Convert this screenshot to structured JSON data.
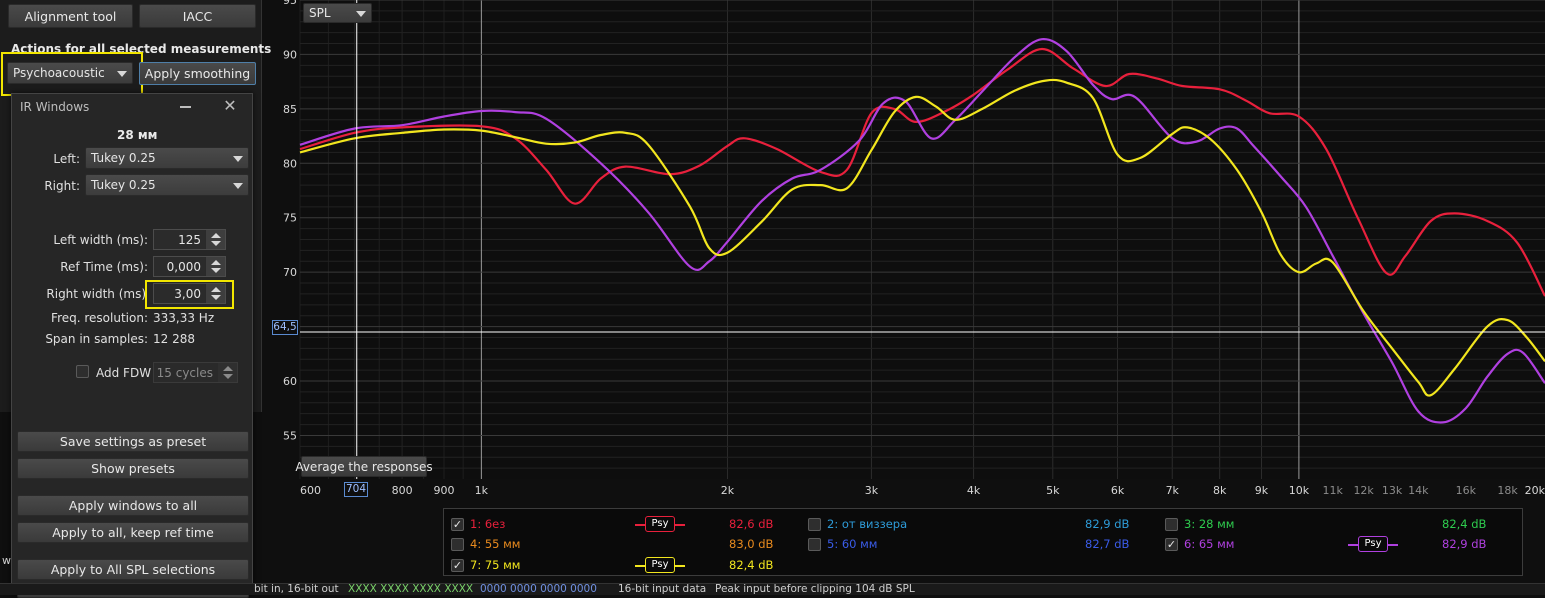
{
  "toolbar": {
    "alignment_tool": "Alignment tool",
    "iacc": "IACC",
    "actions_heading": "Actions for all selected measurements",
    "smoothing_select": "Psychoacoustic",
    "apply_smoothing": "Apply smoothing"
  },
  "ir_windows": {
    "title": "IR Windows",
    "distance": "28 мм",
    "left_label": "Left:",
    "left_value": "Tukey 0.25",
    "right_label": "Right:",
    "right_value": "Tukey 0.25",
    "left_width_label": "Left width (ms):",
    "left_width_value": "125",
    "ref_time_label": "Ref Time (ms):",
    "ref_time_value": "0,000",
    "right_width_label": "Right width (ms)",
    "right_width_value": "3,00",
    "freq_res_label": "Freq. resolution:",
    "freq_res_value": "333,33 Hz",
    "span_label": "Span in samples:",
    "span_value": "12 288",
    "add_fdw_label": "Add FDW",
    "fdw_cycles": "15 cycles",
    "save_preset": "Save settings as preset",
    "show_presets": "Show presets",
    "apply_windows_all": "Apply windows to all",
    "apply_all_keep_ref": "Apply to all, keep ref time",
    "apply_all_spl": "Apply to All SPL selections"
  },
  "chart_panel": {
    "spl_select": "SPL",
    "average_button": "Average the responses",
    "cursor_y_value": "64,5",
    "cursor_x_value": "704"
  },
  "legend": [
    {
      "label": "1: 6ез",
      "value": "82,6 dB",
      "checked": true,
      "color": "#e8203c",
      "psy": "Psy"
    },
    {
      "label": "2: от виззера",
      "value": "82,9 dB",
      "checked": false,
      "color": "#2e9bd8",
      "psy": ""
    },
    {
      "label": "3: 28 мм",
      "value": "82,4 dB",
      "checked": false,
      "color": "#2ecc4e",
      "psy": ""
    },
    {
      "label": "4: 55 мм",
      "value": "83,0 dB",
      "checked": false,
      "color": "#e88a1e",
      "psy": ""
    },
    {
      "label": "5: 60 мм",
      "value": "82,7 dB",
      "checked": false,
      "color": "#3a5ce8",
      "psy": ""
    },
    {
      "label": "6: 65 мм",
      "value": "82,9 dB",
      "checked": true,
      "color": "#b040e0",
      "psy": "Psy"
    },
    {
      "label": "7: 75 мм",
      "value": "82,4 dB",
      "checked": true,
      "color": "#f2e61e",
      "psy": "Psy"
    }
  ],
  "status_bar": {
    "bits": "bit in, 16-bit out",
    "xxxx": "XXXX XXXX   XXXX XXXX",
    "zeros": "0000 0000   0000 0000",
    "input_data": "16-bit input data",
    "peak": "Peak input before clipping 104 dB SPL"
  },
  "chart_data": {
    "type": "line",
    "x_scale": "log",
    "xlim": [
      600,
      20000
    ],
    "ylim": [
      51,
      95
    ],
    "x_ticks": [
      {
        "v": 600,
        "t": "600"
      },
      {
        "v": 800,
        "t": "800"
      },
      {
        "v": 900,
        "t": "900"
      },
      {
        "v": 1000,
        "t": "1k"
      },
      {
        "v": 2000,
        "t": "2k"
      },
      {
        "v": 3000,
        "t": "3k"
      },
      {
        "v": 4000,
        "t": "4k"
      },
      {
        "v": 5000,
        "t": "5k"
      },
      {
        "v": 6000,
        "t": "6k"
      },
      {
        "v": 7000,
        "t": "7k"
      },
      {
        "v": 8000,
        "t": "8k"
      },
      {
        "v": 9000,
        "t": "9k"
      },
      {
        "v": 10000,
        "t": "10k"
      },
      {
        "v": 11000,
        "t": "11k"
      },
      {
        "v": 12000,
        "t": "12k"
      },
      {
        "v": 13000,
        "t": "13k"
      },
      {
        "v": 14000,
        "t": "14k"
      },
      {
        "v": 16000,
        "t": "16k"
      },
      {
        "v": 18000,
        "t": "18k"
      },
      {
        "v": 20000,
        "t": "20k"
      }
    ],
    "y_ticks": [
      55,
      60,
      65,
      70,
      75,
      80,
      85,
      90,
      95
    ],
    "grid": true,
    "cursor": {
      "x": 704,
      "y": 64.5
    },
    "series": [
      {
        "color": "#e8203c",
        "points": [
          [
            600,
            81.3
          ],
          [
            700,
            82.8
          ],
          [
            800,
            83.3
          ],
          [
            1000,
            83.4
          ],
          [
            1100,
            82.3
          ],
          [
            1200,
            79.4
          ],
          [
            1300,
            76.3
          ],
          [
            1400,
            78.6
          ],
          [
            1500,
            79.7
          ],
          [
            1700,
            79.0
          ],
          [
            1850,
            79.8
          ],
          [
            2000,
            81.6
          ],
          [
            2100,
            82.3
          ],
          [
            2300,
            81.3
          ],
          [
            2600,
            79.2
          ],
          [
            2800,
            79.4
          ],
          [
            3000,
            84.6
          ],
          [
            3200,
            85.0
          ],
          [
            3400,
            83.8
          ],
          [
            3700,
            84.8
          ],
          [
            4000,
            86.3
          ],
          [
            4400,
            88.6
          ],
          [
            4850,
            90.5
          ],
          [
            5300,
            88.7
          ],
          [
            5800,
            87.1
          ],
          [
            6200,
            88.2
          ],
          [
            6700,
            87.8
          ],
          [
            7200,
            87.1
          ],
          [
            8000,
            86.8
          ],
          [
            8600,
            85.8
          ],
          [
            9200,
            84.6
          ],
          [
            10000,
            84.3
          ],
          [
            10800,
            81.3
          ],
          [
            11800,
            75.0
          ],
          [
            12800,
            69.9
          ],
          [
            13500,
            71.5
          ],
          [
            14500,
            74.7
          ],
          [
            15500,
            75.4
          ],
          [
            17000,
            74.7
          ],
          [
            18500,
            72.7
          ],
          [
            20000,
            67.8
          ]
        ]
      },
      {
        "color": "#b040e0",
        "points": [
          [
            600,
            81.7
          ],
          [
            700,
            83.2
          ],
          [
            800,
            83.5
          ],
          [
            900,
            84.3
          ],
          [
            1000,
            84.8
          ],
          [
            1100,
            84.7
          ],
          [
            1200,
            84.1
          ],
          [
            1400,
            80.0
          ],
          [
            1600,
            75.5
          ],
          [
            1800,
            70.5
          ],
          [
            1900,
            71.0
          ],
          [
            2000,
            72.8
          ],
          [
            2200,
            76.5
          ],
          [
            2400,
            78.6
          ],
          [
            2600,
            79.4
          ],
          [
            2900,
            82.1
          ],
          [
            3100,
            85.5
          ],
          [
            3300,
            85.7
          ],
          [
            3550,
            82.3
          ],
          [
            3800,
            84.0
          ],
          [
            4100,
            86.6
          ],
          [
            4500,
            89.8
          ],
          [
            4850,
            91.4
          ],
          [
            5200,
            90.3
          ],
          [
            5600,
            87.2
          ],
          [
            5900,
            85.9
          ],
          [
            6300,
            86.1
          ],
          [
            7000,
            82.3
          ],
          [
            7500,
            82.0
          ],
          [
            8000,
            83.2
          ],
          [
            8400,
            83.2
          ],
          [
            8800,
            81.6
          ],
          [
            9500,
            78.8
          ],
          [
            10200,
            76.0
          ],
          [
            11000,
            71.5
          ],
          [
            12000,
            66.2
          ],
          [
            13000,
            61.7
          ],
          [
            14000,
            57.2
          ],
          [
            15000,
            56.2
          ],
          [
            16000,
            57.5
          ],
          [
            17000,
            60.4
          ],
          [
            18000,
            62.5
          ],
          [
            18800,
            62.6
          ],
          [
            20000,
            59.8
          ]
        ]
      },
      {
        "color": "#f2e61e",
        "points": [
          [
            600,
            81.0
          ],
          [
            700,
            82.3
          ],
          [
            800,
            82.8
          ],
          [
            900,
            83.1
          ],
          [
            1000,
            83.0
          ],
          [
            1100,
            82.4
          ],
          [
            1200,
            81.8
          ],
          [
            1300,
            81.9
          ],
          [
            1400,
            82.6
          ],
          [
            1500,
            82.8
          ],
          [
            1600,
            81.7
          ],
          [
            1800,
            76.0
          ],
          [
            1900,
            72.2
          ],
          [
            2000,
            71.8
          ],
          [
            2200,
            74.6
          ],
          [
            2400,
            77.6
          ],
          [
            2600,
            78.0
          ],
          [
            2800,
            77.7
          ],
          [
            3000,
            81.2
          ],
          [
            3200,
            84.7
          ],
          [
            3400,
            86.1
          ],
          [
            3600,
            85.2
          ],
          [
            3800,
            84.0
          ],
          [
            4100,
            85.0
          ],
          [
            4500,
            86.7
          ],
          [
            4900,
            87.6
          ],
          [
            5200,
            87.4
          ],
          [
            5600,
            86.0
          ],
          [
            6000,
            80.8
          ],
          [
            6400,
            80.5
          ],
          [
            7000,
            82.7
          ],
          [
            7300,
            83.3
          ],
          [
            7800,
            82.2
          ],
          [
            8400,
            79.4
          ],
          [
            9000,
            75.5
          ],
          [
            9500,
            71.6
          ],
          [
            10000,
            70.0
          ],
          [
            10500,
            70.8
          ],
          [
            11000,
            70.9
          ],
          [
            12000,
            66.4
          ],
          [
            13000,
            63.0
          ],
          [
            14000,
            59.9
          ],
          [
            14500,
            58.7
          ],
          [
            15500,
            61.1
          ],
          [
            17000,
            65.0
          ],
          [
            18000,
            65.6
          ],
          [
            19000,
            64.0
          ],
          [
            20000,
            61.8
          ]
        ]
      }
    ]
  }
}
